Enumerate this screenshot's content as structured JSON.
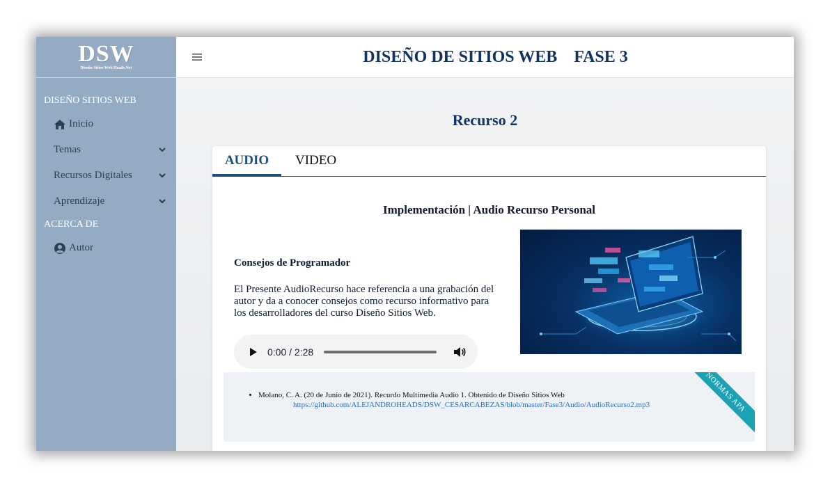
{
  "sidebar": {
    "logo": "DSW",
    "logo_sub": "Diseño Sitios Web Heads.Net",
    "section1": "DISEÑO SITIOS WEB",
    "items": [
      {
        "label": "Inicio",
        "icon": "home-icon"
      },
      {
        "label": "Temas",
        "icon": "chevron-down-icon"
      },
      {
        "label": "Recursos Digitales",
        "icon": "chevron-down-icon"
      },
      {
        "label": "Aprendizaje",
        "icon": "chevron-down-icon"
      }
    ],
    "section2": "ACERCA DE",
    "author": {
      "label": "Autor",
      "icon": "user-circle-icon"
    }
  },
  "header": {
    "title": "DISEÑO DE SITIOS WEB",
    "phase": "FASE 3",
    "menu_icon": "hamburger-icon"
  },
  "main": {
    "page_title": "Recurso 2",
    "tabs": [
      {
        "label": "AUDIO",
        "active": true
      },
      {
        "label": "VIDEO",
        "active": false
      }
    ],
    "subtitle": "Implementación | Audio Recurso Personal",
    "tips_heading": "Consejos de Programador",
    "tips_text": "El Presente AudioRecurso hace referencia a una grabación del autor y da a conocer consejos como recurso informativo para los desarrolladores del curso Diseño Sitios Web.",
    "audio": {
      "time": "0:00 / 2:28",
      "progress": 0
    }
  },
  "references": {
    "citation": "Molano, C. A. (20 de Junio de 2021). Recurdo Multimedia Audio 1. Obtenido de Diseño Sitios Web",
    "url": "https://github.com/ALEJANDROHEADS/DSW_CESARCABEZAS/blob/master/Fase3/Audio/AudioRecurso2.mp3",
    "ribbon": "NORMAS APA"
  },
  "colors": {
    "sidebar": "#95abc4",
    "title": "#123262",
    "tab_active": "#1f4f79",
    "ribbon": "#1aa3b4"
  }
}
